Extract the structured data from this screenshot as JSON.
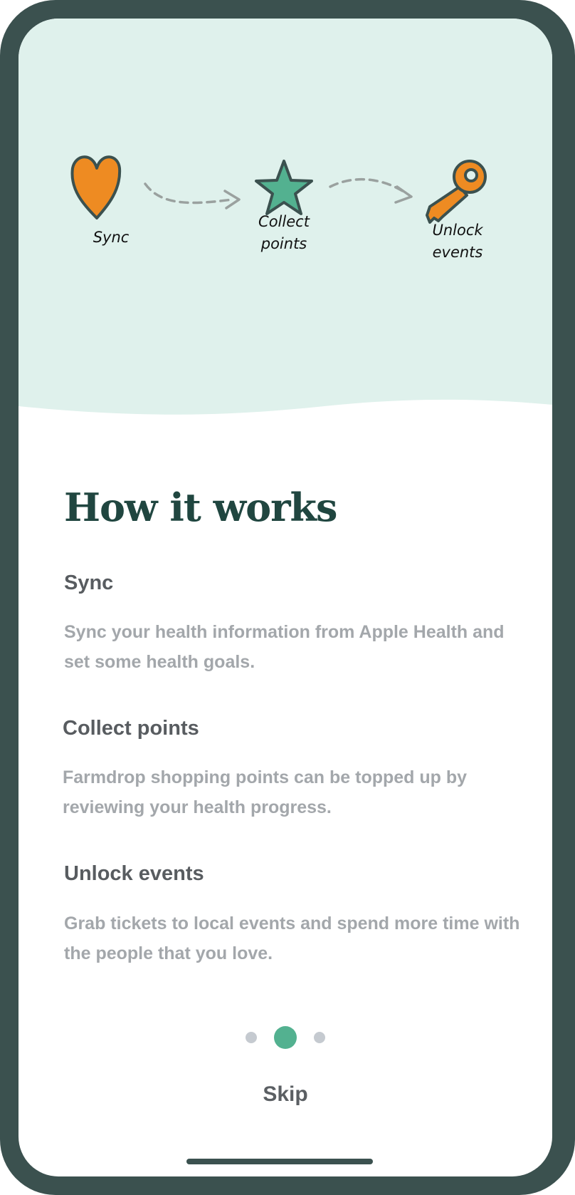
{
  "colors": {
    "frame": "#3b514f",
    "hero_background": "#dff1ec",
    "title": "#204640",
    "heading": "#585c60",
    "body_text": "#a3a7ab",
    "dot_inactive": "#c5cad0",
    "dot_active": "#53b190",
    "heart": "#ee8b22",
    "star": "#53b190",
    "key": "#ee8b22"
  },
  "hero": {
    "steps": [
      {
        "icon": "heart-icon",
        "label": "Sync"
      },
      {
        "icon": "star-icon",
        "label": "Collect\npoints"
      },
      {
        "icon": "key-icon",
        "label": "Unlock\nevents"
      }
    ]
  },
  "content": {
    "title": "How it works",
    "items": [
      {
        "heading": "Sync",
        "body": "Sync your health information from Apple Health and set some health goals."
      },
      {
        "heading": "Collect points",
        "body": "Farmdrop shopping points can be topped up by reviewing your health progress."
      },
      {
        "heading": "Unlock events",
        "body": "Grab tickets to local events and spend more time with the people that you love."
      }
    ]
  },
  "pagination": {
    "page_count": 3,
    "current_page": 2
  },
  "skip_label": "Skip"
}
